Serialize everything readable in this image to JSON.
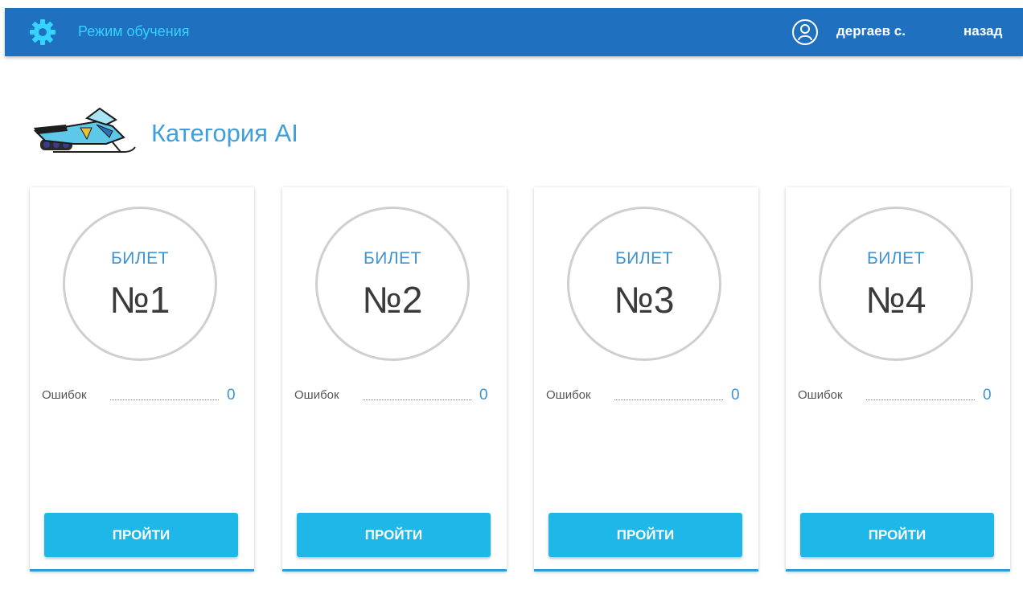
{
  "header": {
    "mode_title": "Режим обучения",
    "user_name": "дергаев с.",
    "back_label": "назад"
  },
  "category": {
    "title": "Категория AI",
    "image_icon": "snowmobile-icon"
  },
  "tickets": [
    {
      "word": "БИЛЕТ",
      "number": "№1",
      "errors_label": "Ошибок",
      "errors_count": "0",
      "button_label": "ПРОЙТИ"
    },
    {
      "word": "БИЛЕТ",
      "number": "№2",
      "errors_label": "Ошибок",
      "errors_count": "0",
      "button_label": "ПРОЙТИ"
    },
    {
      "word": "БИЛЕТ",
      "number": "№3",
      "errors_label": "Ошибок",
      "errors_count": "0",
      "button_label": "ПРОЙТИ"
    },
    {
      "word": "БИЛЕТ",
      "number": "№4",
      "errors_label": "Ошибок",
      "errors_count": "0",
      "button_label": "ПРОЙТИ"
    }
  ],
  "colors": {
    "header_bg": "#2070c0",
    "accent_text": "#35d3ff",
    "button_bg": "#1fb6e8",
    "title_blue": "#3f9fdc"
  },
  "icons": {
    "gear": "gear-icon",
    "user": "user-icon"
  }
}
